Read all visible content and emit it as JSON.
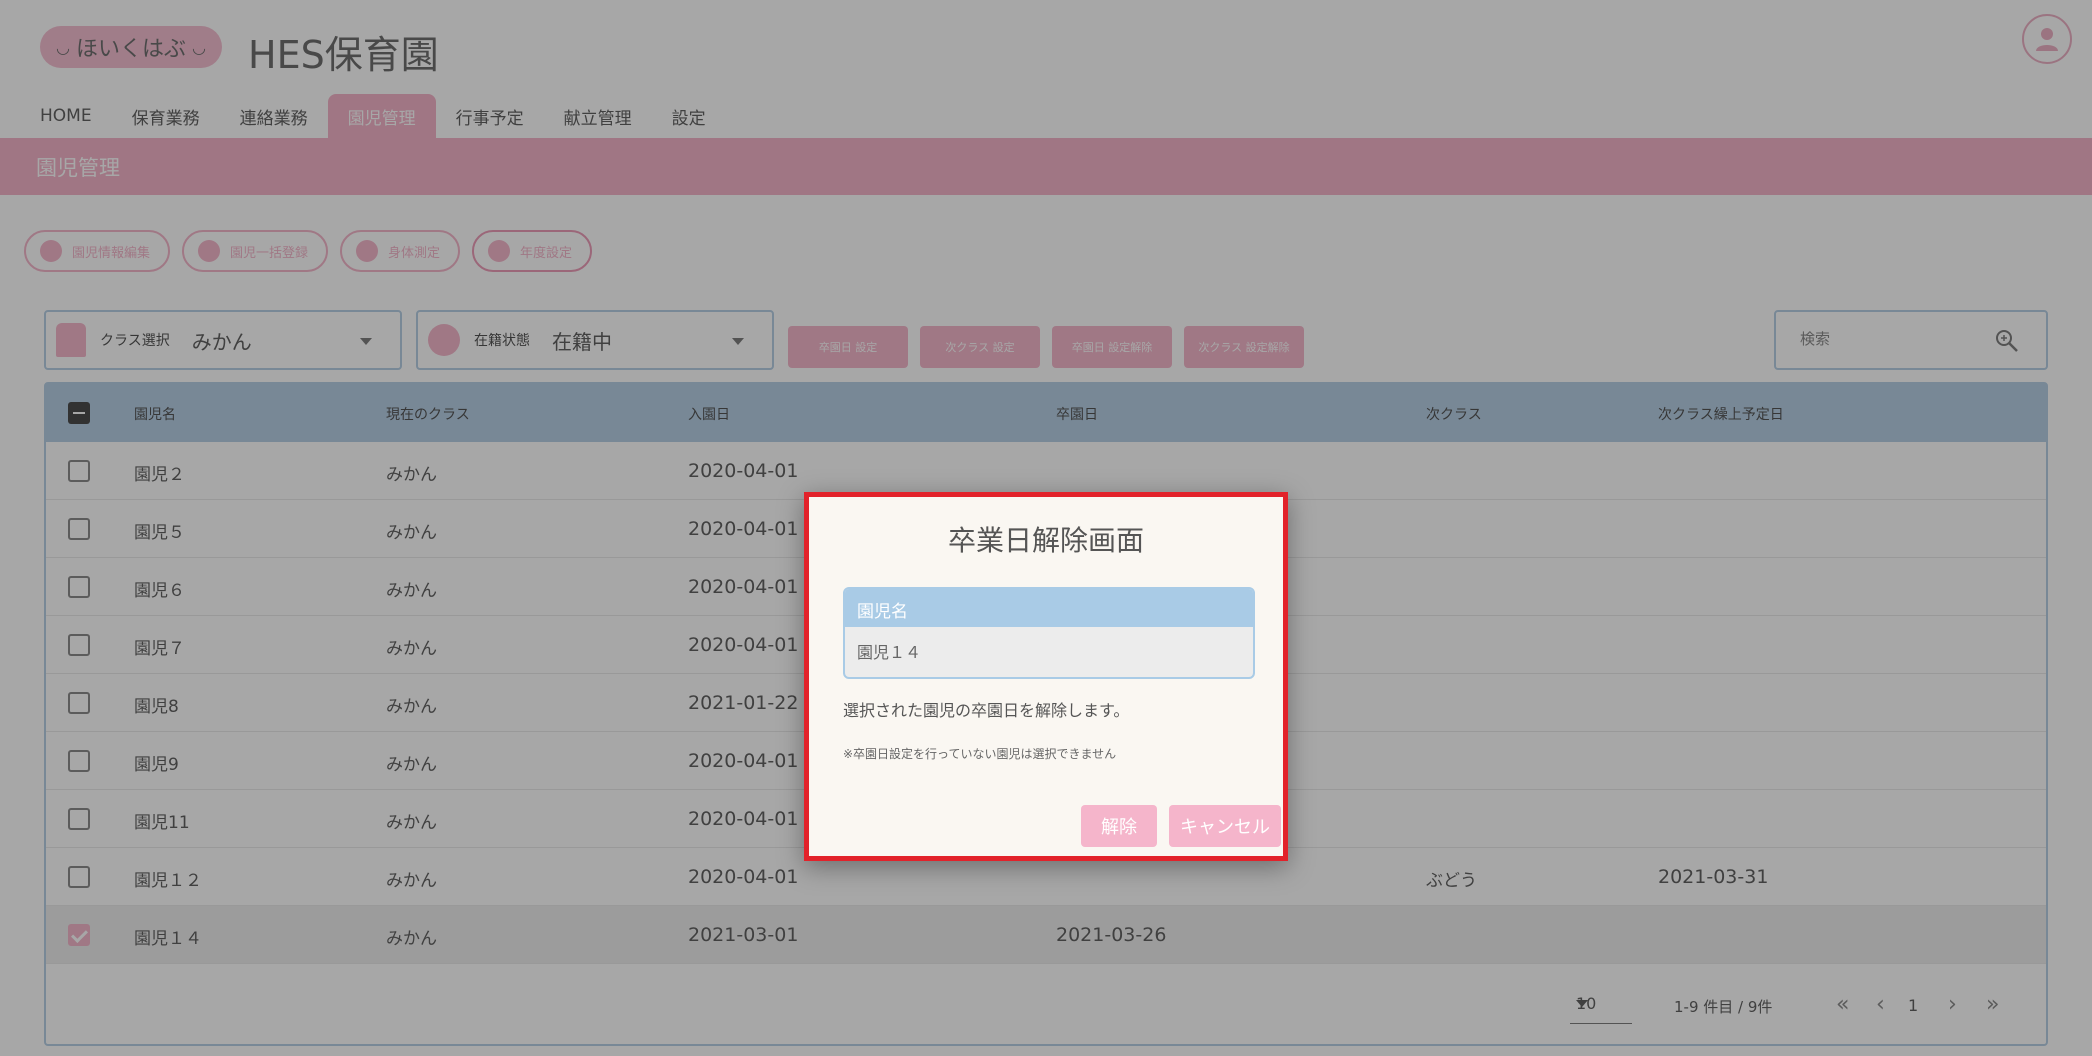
{
  "header": {
    "logo_text": "ほいくはぶ",
    "site_title": "HES保育園"
  },
  "nav": {
    "items": [
      "HOME",
      "保育業務",
      "連絡業務",
      "園児管理",
      "行事予定",
      "献立管理",
      "設定"
    ],
    "active": "園児管理"
  },
  "page_title": "園児管理",
  "actions": [
    "園児情報編集",
    "園児一括登録",
    "身体測定",
    "年度設定"
  ],
  "filters": {
    "class": {
      "label": "クラス選択",
      "value": "みかん"
    },
    "status": {
      "label": "在籍状態",
      "value": "在籍中"
    }
  },
  "toolbar_buttons": [
    "卒園日 設定",
    "次クラス 設定",
    "卒園日 設定解除",
    "次クラス 設定解除"
  ],
  "search": {
    "placeholder": "検索"
  },
  "table": {
    "headers": [
      "園児名",
      "現在のクラス",
      "入園日",
      "卒園日",
      "次クラス",
      "次クラス繰上予定日"
    ],
    "rows": [
      {
        "name": "園児２",
        "class": "みかん",
        "enroll": "2020-04-01",
        "grad": "",
        "next": "",
        "next_date": "",
        "checked": false
      },
      {
        "name": "園児５",
        "class": "みかん",
        "enroll": "2020-04-01",
        "grad": "",
        "next": "",
        "next_date": "",
        "checked": false
      },
      {
        "name": "園児６",
        "class": "みかん",
        "enroll": "2020-04-01",
        "grad": "",
        "next": "",
        "next_date": "",
        "checked": false
      },
      {
        "name": "園児７",
        "class": "みかん",
        "enroll": "2020-04-01",
        "grad": "",
        "next": "",
        "next_date": "",
        "checked": false
      },
      {
        "name": "園児8",
        "class": "みかん",
        "enroll": "2021-01-22",
        "grad": "",
        "next": "",
        "next_date": "",
        "checked": false
      },
      {
        "name": "園児9",
        "class": "みかん",
        "enroll": "2020-04-01",
        "grad": "",
        "next": "",
        "next_date": "",
        "checked": false
      },
      {
        "name": "園児11",
        "class": "みかん",
        "enroll": "2020-04-01",
        "grad": "",
        "next": "",
        "next_date": "",
        "checked": false
      },
      {
        "name": "園児１２",
        "class": "みかん",
        "enroll": "2020-04-01",
        "grad": "",
        "next": "ぶどう",
        "next_date": "2021-03-31",
        "checked": false
      },
      {
        "name": "園児１４",
        "class": "みかん",
        "enroll": "2021-03-01",
        "grad": "2021-03-26",
        "next": "",
        "next_date": "",
        "checked": true
      }
    ]
  },
  "pagination": {
    "page_size": "10",
    "info": "1-9 件目 / 9件",
    "current_page": "1"
  },
  "modal": {
    "title": "卒業日解除画面",
    "field_label": "園児名",
    "field_value": "園児１４",
    "description": "選択された園児の卒園日を解除します。",
    "note": "※卒園日設定を行っていない園児は選択できません",
    "confirm_label": "解除",
    "cancel_label": "キャンセル"
  },
  "colors": {
    "accent_pink": "#f2a6c0",
    "table_header_blue": "#a9c6e0",
    "modal_border_red": "#e2222a"
  }
}
